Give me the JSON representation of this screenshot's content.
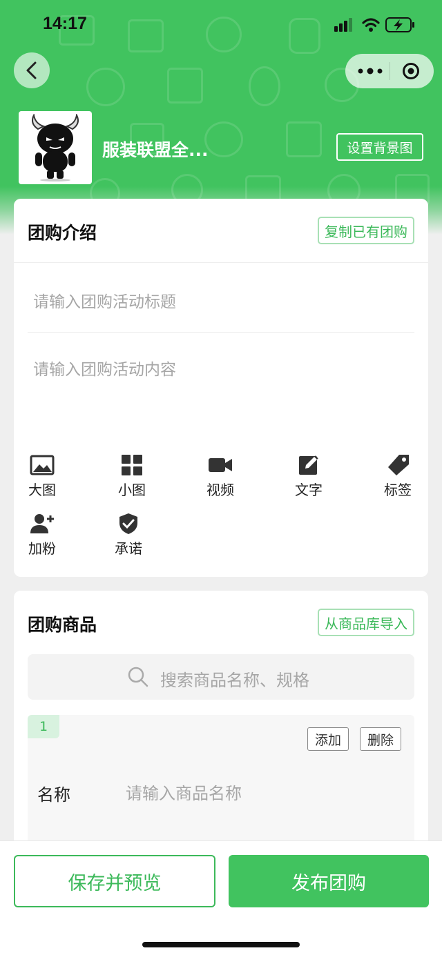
{
  "status_bar": {
    "time": "14:17"
  },
  "nav": {
    "back_icon": "chevron-left-icon",
    "more_icon": "more-dots-icon",
    "close_icon": "target-icon"
  },
  "shop": {
    "name": "服装联盟全...",
    "set_background_label": "设置背景图"
  },
  "intro": {
    "title": "团购介绍",
    "copy_button": "复制已有团购",
    "title_placeholder": "请输入团购活动标题",
    "content_placeholder": "请输入团购活动内容",
    "tools": [
      {
        "label": "大图",
        "icon": "image-icon"
      },
      {
        "label": "小图",
        "icon": "grid-icon"
      },
      {
        "label": "视频",
        "icon": "video-icon"
      },
      {
        "label": "文字",
        "icon": "edit-icon"
      },
      {
        "label": "标签",
        "icon": "tag-icon"
      },
      {
        "label": "加粉",
        "icon": "add-user-icon"
      },
      {
        "label": "承诺",
        "icon": "shield-check-icon"
      }
    ]
  },
  "products": {
    "title": "团购商品",
    "import_button": "从商品库导入",
    "search_placeholder": "搜索商品名称、规格",
    "items": [
      {
        "index": "1",
        "add_label": "添加",
        "delete_label": "删除",
        "name_label": "名称",
        "name_placeholder": "请输入商品名称"
      }
    ]
  },
  "footer": {
    "save_preview_label": "保存并预览",
    "publish_label": "发布团购"
  },
  "colors": {
    "brand": "#41c35f",
    "brand_text": "#3cb95a",
    "page_bg": "#efefef"
  }
}
